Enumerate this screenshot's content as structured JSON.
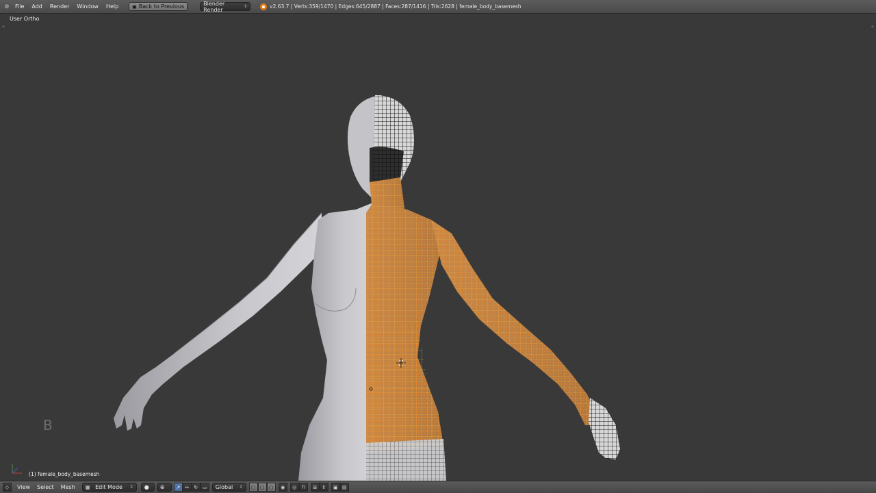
{
  "header": {
    "menus": [
      "File",
      "Add",
      "Render",
      "Window",
      "Help"
    ],
    "back_button": "Back to Previous",
    "render_engine": "Blender Render",
    "stats": "v2.63.7 | Verts:359/1470 | Edges:645/2887 | Faces:287/1416 | Tris:2628 | female_body_basemesh"
  },
  "viewport": {
    "view_name": "User Ortho",
    "overlay_letter": "B",
    "object_label": "(1) female_body_basemesh"
  },
  "footer": {
    "menus": [
      "View",
      "Select",
      "Mesh"
    ],
    "mode": "Edit Mode",
    "orientation": "Global"
  },
  "colors": {
    "background": "#393939",
    "selection": "#f0a040",
    "mesh_gray": "#b8b8bc"
  }
}
